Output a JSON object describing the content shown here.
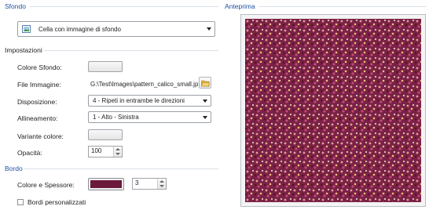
{
  "sfondo": {
    "title": "Sfondo",
    "type_combo": {
      "value": "Cella con immagine di sfondo",
      "icon": "image-cell-icon"
    }
  },
  "impostazioni": {
    "title": "Impostazioni",
    "colore_sfondo_label": "Colore Sfondo:",
    "file_immagine_label": "File Immagine:",
    "file_immagine_value": "G:\\Test\\Images\\pattern_calico_small.jp",
    "disposizione_label": "Disposizione:",
    "disposizione_value": "4 - Ripeti in entrambe le direzioni",
    "allineamento_label": "Allineamento:",
    "allineamento_value": "1 - Alto - Sinistra",
    "variante_colore_label": "Variante colore:",
    "opacita_label": "Opacità:",
    "opacita_value": "100"
  },
  "bordo": {
    "title": "Bordo",
    "colore_spessore_label": "Colore e Spessore:",
    "border_color": "#6b1a3b",
    "spessore_value": "3",
    "bordi_personalizzati_label": "Bordi personalizzati"
  },
  "anteprima": {
    "title": "Anteprima",
    "pattern_base_color": "#7a2246"
  }
}
